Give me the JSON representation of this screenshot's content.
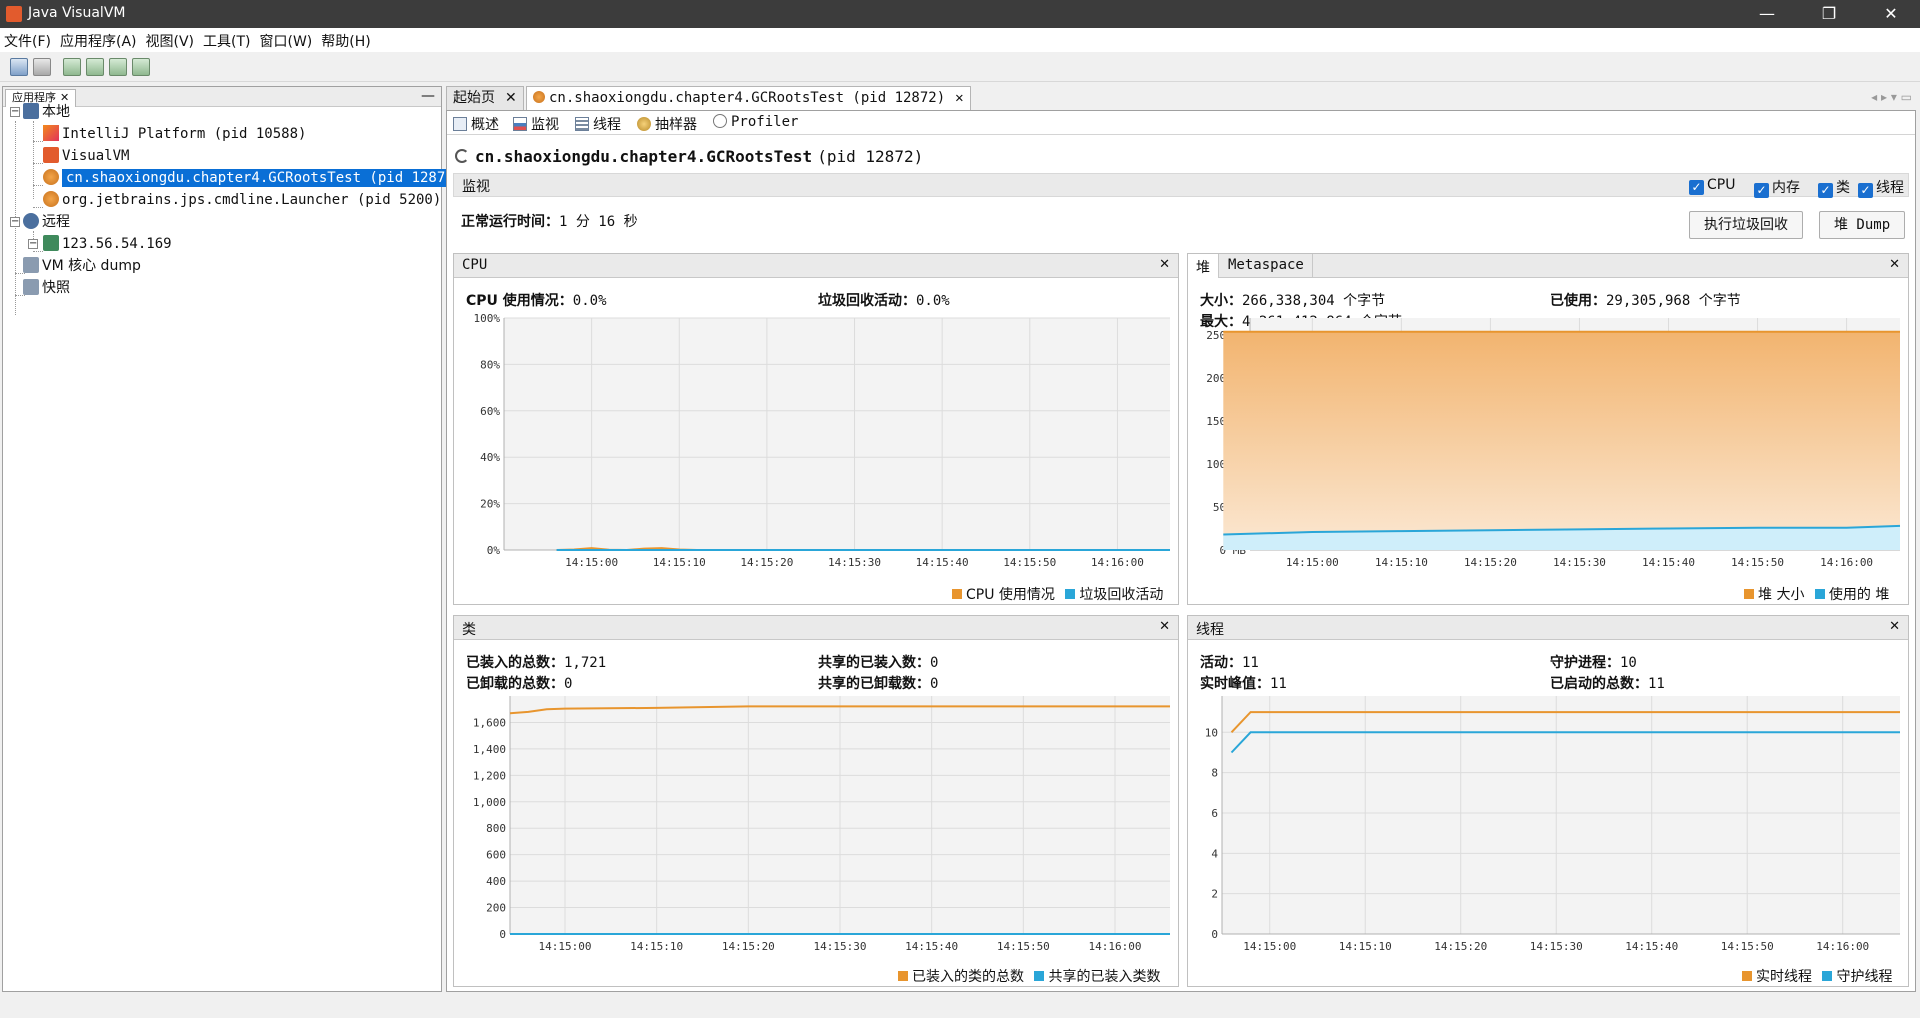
{
  "window": {
    "title": "Java VisualVM",
    "minimize": "—",
    "maximize": "❐",
    "close": "✕"
  },
  "menu": [
    "文件(F)",
    "应用程序(A)",
    "视图(V)",
    "工具(T)",
    "窗口(W)",
    "帮助(H)"
  ],
  "left_panel": {
    "tab_label": "应用程序",
    "tab_close": "✕",
    "minimize": "—",
    "tree": {
      "local_label": "本地",
      "local_items": [
        "IntelliJ Platform (pid 10588)",
        "VisualVM",
        "cn.shaoxiongdu.chapter4.GCRootsTest (pid 12872)",
        "org.jetbrains.jps.cmdline.Launcher (pid 5200)"
      ],
      "remote_label": "远程",
      "remote_items": [
        "123.56.54.169"
      ],
      "vm_dump_label": "VM 核心 dump",
      "snapshot_label": "快照"
    }
  },
  "doc_tabs": [
    {
      "label": "起始页",
      "close": "✕"
    },
    {
      "label": "cn.shaoxiongdu.chapter4.GCRootsTest (pid 12872)",
      "close": "✕"
    }
  ],
  "tab_nav": "◂ ▸ ▾ ▭",
  "subtabs": [
    "概述",
    "监视",
    "线程",
    "抽样器",
    "Profiler"
  ],
  "header": {
    "app_name": "cn.shaoxiongdu.chapter4.GCRootsTest",
    "pid": "(pid 12872)"
  },
  "monitor": {
    "title": "监视",
    "checkboxes": [
      "CPU",
      "内存",
      "类",
      "线程"
    ],
    "uptime_label": "正常运行时间：",
    "uptime_value": "1 分 16 秒",
    "gc_button": "执行垃圾回收",
    "heap_dump_button": "堆 Dump"
  },
  "cpu_panel": {
    "title": "CPU",
    "close": "✕",
    "usage_label": "CPU 使用情况：",
    "usage_value": "0.0%",
    "gc_label": "垃圾回收活动：",
    "gc_value": "0.0%",
    "legend": [
      "CPU 使用情况",
      "垃圾回收活动"
    ]
  },
  "heap_panel": {
    "tabs": [
      "堆",
      "Metaspace"
    ],
    "close": "✕",
    "size_label": "大小：",
    "size_value": "266,338,304 个字节",
    "used_label": "已使用：",
    "used_value": "29,305,968 个字节",
    "max_label": "最大：",
    "max_value": "4,261,412,864 个字节",
    "legend": [
      "堆 大小",
      "使用的 堆"
    ]
  },
  "classes_panel": {
    "title": "类",
    "close": "✕",
    "loaded_label": "已装入的总数：",
    "loaded_value": "1,721",
    "unloaded_label": "已卸载的总数：",
    "unloaded_value": "0",
    "shared_loaded_label": "共享的已装入数：",
    "shared_loaded_value": "0",
    "shared_unloaded_label": "共享的已卸载数：",
    "shared_unloaded_value": "0",
    "legend": [
      "已装入的类的总数",
      "共享的已装入类数"
    ]
  },
  "threads_panel": {
    "title": "线程",
    "close": "✕",
    "live_label": "活动：",
    "live_value": "11",
    "peak_label": "实时峰值：",
    "peak_value": "11",
    "daemon_label": "守护进程：",
    "daemon_value": "10",
    "started_label": "已启动的总数：",
    "started_value": "11",
    "legend": [
      "实时线程",
      "守护线程"
    ]
  },
  "colors": {
    "orange": "#e8952e",
    "blue": "#2aa6d8",
    "heap_fill_top": "#f2b46f",
    "heap_fill_bottom": "#fbe8d3",
    "blue_fill": "#cfeefa",
    "selection": "#0a6fd6"
  },
  "chart_data": [
    {
      "id": "cpu",
      "type": "line",
      "x": [
        "14:14:56",
        "14:14:58",
        "14:15:00",
        "14:15:02",
        "14:15:04",
        "14:15:06",
        "14:15:08",
        "14:15:10",
        "14:15:12",
        "14:15:20",
        "14:15:30",
        "14:15:40",
        "14:15:50",
        "14:16:00",
        "14:16:06"
      ],
      "x_ticks": [
        "14:15:00",
        "14:15:10",
        "14:15:20",
        "14:15:30",
        "14:15:40",
        "14:15:50",
        "14:16:00"
      ],
      "y_ticks": [
        "0%",
        "20%",
        "40%",
        "60%",
        "80%",
        "100%"
      ],
      "ylim": [
        0,
        100
      ],
      "series": [
        {
          "name": "CPU 使用情况",
          "values": [
            0,
            0.2,
            0.8,
            0.1,
            0,
            0.6,
            0.8,
            0.2,
            0,
            0,
            0,
            0,
            0,
            0,
            0
          ]
        },
        {
          "name": "垃圾回收活动",
          "values": [
            0,
            0,
            0,
            0,
            0,
            0,
            0,
            0,
            0,
            0,
            0,
            0,
            0,
            0,
            0
          ]
        }
      ]
    },
    {
      "id": "heap",
      "type": "area",
      "x": [
        "14:14:50",
        "14:15:00",
        "14:15:10",
        "14:15:20",
        "14:15:30",
        "14:15:40",
        "14:15:50",
        "14:16:00",
        "14:16:06"
      ],
      "x_ticks": [
        "14:15:00",
        "14:15:10",
        "14:15:20",
        "14:15:30",
        "14:15:40",
        "14:15:50",
        "14:16:00"
      ],
      "y_ticks": [
        "0 MB",
        "50 MB",
        "100 MB",
        "150 MB",
        "200 MB",
        "250 MB"
      ],
      "ylim": [
        0,
        270
      ],
      "series": [
        {
          "name": "堆 大小",
          "values": [
            254,
            254,
            254,
            254,
            254,
            254,
            254,
            254,
            254
          ]
        },
        {
          "name": "使用的 堆",
          "values": [
            18,
            21,
            22,
            23,
            24,
            25,
            26,
            26,
            28
          ]
        }
      ]
    },
    {
      "id": "classes",
      "type": "line",
      "x": [
        "14:14:54",
        "14:14:56",
        "14:14:58",
        "14:15:00",
        "14:15:10",
        "14:15:20",
        "14:15:30",
        "14:15:40",
        "14:15:50",
        "14:16:00",
        "14:16:06"
      ],
      "x_ticks": [
        "14:15:00",
        "14:15:10",
        "14:15:20",
        "14:15:30",
        "14:15:40",
        "14:15:50",
        "14:16:00"
      ],
      "y_ticks": [
        "0",
        "200",
        "400",
        "600",
        "800",
        "1,000",
        "1,200",
        "1,400",
        "1,600"
      ],
      "ylim": [
        0,
        1800
      ],
      "series": [
        {
          "name": "已装入的类的总数",
          "values": [
            1670,
            1680,
            1700,
            1705,
            1710,
            1721,
            1721,
            1721,
            1721,
            1721,
            1721
          ]
        },
        {
          "name": "共享的已装入类数",
          "values": [
            0,
            0,
            0,
            0,
            0,
            0,
            0,
            0,
            0,
            0,
            0
          ]
        }
      ]
    },
    {
      "id": "threads",
      "type": "line",
      "x": [
        "14:14:56",
        "14:14:58",
        "14:15:00",
        "14:15:10",
        "14:15:20",
        "14:15:30",
        "14:15:40",
        "14:15:50",
        "14:16:00",
        "14:16:06"
      ],
      "x_ticks": [
        "14:15:00",
        "14:15:10",
        "14:15:20",
        "14:15:30",
        "14:15:40",
        "14:15:50",
        "14:16:00"
      ],
      "y_ticks": [
        "0",
        "2",
        "4",
        "6",
        "8",
        "10"
      ],
      "ylim": [
        0,
        11.8
      ],
      "series": [
        {
          "name": "实时线程",
          "values": [
            10,
            11,
            11,
            11,
            11,
            11,
            11,
            11,
            11,
            11
          ]
        },
        {
          "name": "守护线程",
          "values": [
            9,
            10,
            10,
            10,
            10,
            10,
            10,
            10,
            10,
            10
          ]
        }
      ]
    }
  ]
}
